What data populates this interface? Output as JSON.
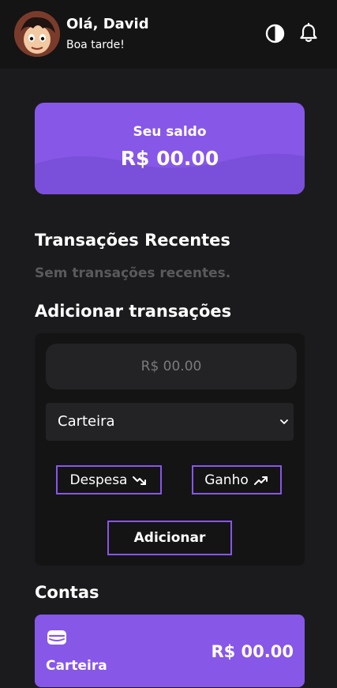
{
  "header": {
    "greeting": "Olá, David",
    "subtitle": "Boa tarde!"
  },
  "balance": {
    "label": "Seu saldo",
    "value": "R$ 00.00"
  },
  "recent": {
    "title": "Transações Recentes",
    "empty": "Sem transações recentes."
  },
  "add_transaction": {
    "title": "Adicionar transações",
    "amount_placeholder": "R$ 00.00",
    "account_selected": "Carteira",
    "expense_label": "Despesa",
    "income_label": "Ganho",
    "submit_label": "Adicionar"
  },
  "accounts": {
    "title": "Contas",
    "items": [
      {
        "name": "Carteira",
        "amount": "R$ 00.00"
      }
    ]
  },
  "icons": {
    "theme": "contrast-icon",
    "notifications": "bell-icon",
    "expense": "trending-down-icon",
    "income": "trending-up-icon",
    "account": "wallet-icon",
    "select": "chevron-down-icon"
  },
  "colors": {
    "background": "#1b1b1d",
    "header": "#141414",
    "accent": "#8757e8",
    "muted_text": "#5a5a5c"
  }
}
